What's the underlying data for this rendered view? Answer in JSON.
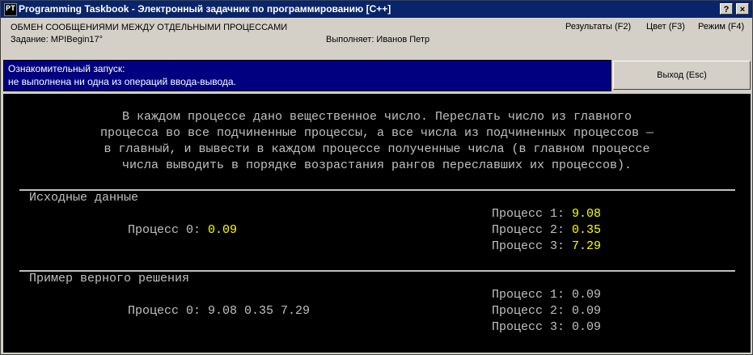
{
  "window": {
    "icon_glyph": "PT",
    "title": "Programming Taskbook - Электронный задачник по программированию [C++]",
    "help_glyph": "?",
    "close_glyph": "×"
  },
  "header": {
    "section_title": "ОБМЕН СООБЩЕНИЯМИ МЕЖДУ ОТДЕЛЬНЫМИ ПРОЦЕССАМИ",
    "task": "Задание: MPIBegin17°",
    "performer": "Выполняет: Иванов Петр"
  },
  "menu": {
    "results": "Результаты (F2)",
    "color": "Цвет (F3)",
    "mode": "Режим (F4)"
  },
  "status": {
    "line1": "Ознакомительный запуск:",
    "line2": " не выполнена ни одна из операций ввода-вывода."
  },
  "exit_button": "Выход (Esc)",
  "description": [
    "В каждом процессе дано вещественное число. Переслать число из главного",
    "процесса во все подчиненные процессы, а все числа из подчиненных процессов —",
    "в главный, и вывести в каждом процессе полученные числа (в главном процессе",
    "числа выводить в порядке возрастания рангов переславших их процессов)."
  ],
  "input": {
    "heading": "Исходные данные",
    "main": {
      "label": "Процесс 0:",
      "value": "0.09"
    },
    "slaves": [
      {
        "label": "Процесс 1:",
        "value": "9.08"
      },
      {
        "label": "Процесс 2:",
        "value": "0.35"
      },
      {
        "label": "Процесс 3:",
        "value": "7.29"
      }
    ]
  },
  "example": {
    "heading": "Пример верного решения",
    "main": {
      "label": "Процесс 0:",
      "value": "9.08 0.35 7.29"
    },
    "slaves": [
      {
        "label": "Процесс 1:",
        "value": "0.09"
      },
      {
        "label": "Процесс 2:",
        "value": "0.09"
      },
      {
        "label": "Процесс 3:",
        "value": "0.09"
      }
    ]
  },
  "colors": {
    "titlebar": "#0a246a",
    "status_bg": "#000080",
    "console_bg": "#000000",
    "console_text": "#c0c0c0",
    "data_value": "#ffff00"
  }
}
